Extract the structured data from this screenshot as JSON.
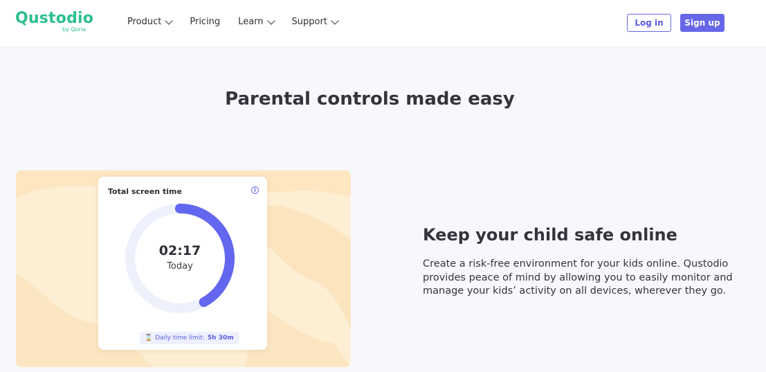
{
  "header": {
    "logo": {
      "name": "Qustodio",
      "sub": "by Qoria"
    },
    "nav": [
      {
        "label": "Product",
        "dropdown": true
      },
      {
        "label": "Pricing",
        "dropdown": false
      },
      {
        "label": "Learn",
        "dropdown": true
      },
      {
        "label": "Support",
        "dropdown": true
      }
    ],
    "login_label": "Log in",
    "signup_label": "Sign up"
  },
  "hero": {
    "title": "Parental controls made easy"
  },
  "card": {
    "title": "Total screen time",
    "info_icon": "info-icon",
    "time": "02:17",
    "period": "Today",
    "limit_label": "Daily time limit:",
    "limit_value": "5h 30m",
    "limit_icon": "hourglass-icon",
    "progress_fraction": 0.42,
    "colors": {
      "track": "#eef0fb",
      "progress": "#6366ef"
    }
  },
  "section": {
    "title": "Keep your child safe online",
    "body": "Create a risk-free environment for your kids online. Qustodio provides peace of mind by allowing you to easily monitor and manage your kids’ activity on all devices, wherever they go."
  },
  "colors": {
    "brand_green": "#2cbf8e",
    "accent": "#6666e8",
    "page_bg": "#f6f8fb",
    "illus_bg": "#fdefd4"
  }
}
